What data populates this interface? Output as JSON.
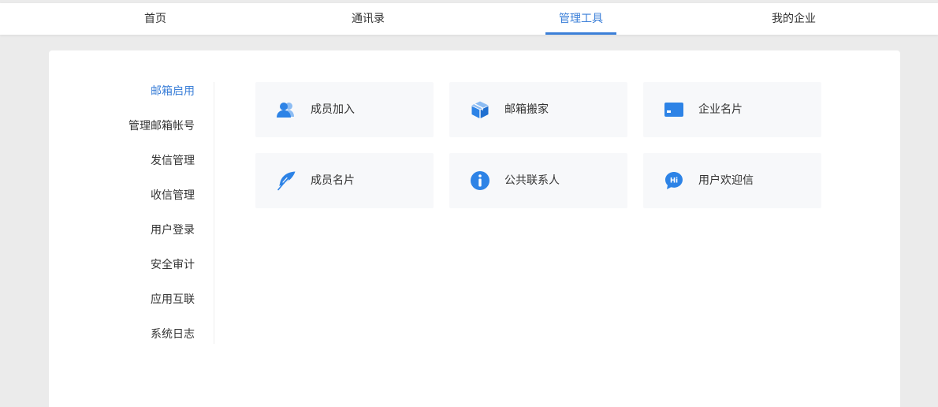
{
  "colors": {
    "accent": "#3b7fd8",
    "icon": "#2d83e6",
    "card_bg": "#f7f8fa",
    "page_bg": "#ebebeb"
  },
  "topnav": {
    "items": [
      {
        "label": "首页"
      },
      {
        "label": "通讯录"
      },
      {
        "label": "管理工具",
        "active": true
      },
      {
        "label": "我的企业"
      }
    ]
  },
  "sidebar": {
    "items": [
      {
        "label": "邮箱启用",
        "active": true
      },
      {
        "label": "管理邮箱帐号"
      },
      {
        "label": "发信管理"
      },
      {
        "label": "收信管理"
      },
      {
        "label": "用户登录"
      },
      {
        "label": "安全审计"
      },
      {
        "label": "应用互联"
      },
      {
        "label": "系统日志"
      }
    ]
  },
  "tools": [
    {
      "label": "成员加入",
      "icon": "users-icon"
    },
    {
      "label": "邮箱搬家",
      "icon": "box-icon"
    },
    {
      "label": "企业名片",
      "icon": "card-icon"
    },
    {
      "label": "成员名片",
      "icon": "feather-icon"
    },
    {
      "label": "公共联系人",
      "icon": "info-icon"
    },
    {
      "label": "用户欢迎信",
      "icon": "hi-chat-icon",
      "icon_text": "Hi"
    }
  ]
}
